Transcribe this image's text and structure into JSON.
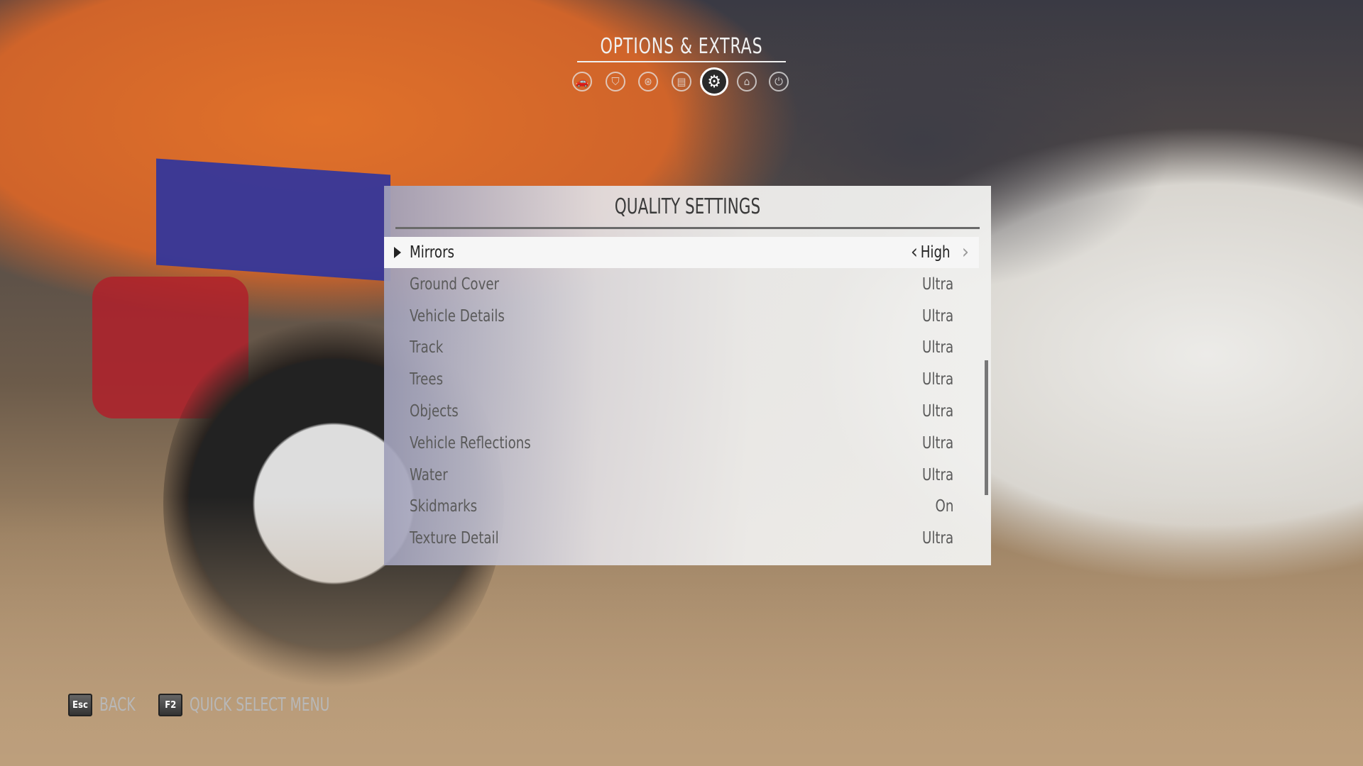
{
  "header": {
    "title": "OPTIONS & EXTRAS",
    "tabs": [
      {
        "icon": "car-icon",
        "glyph": "🚗"
      },
      {
        "icon": "badge-icon",
        "glyph": "⛉"
      },
      {
        "icon": "wheel-icon",
        "glyph": "⊛"
      },
      {
        "icon": "id-card-icon",
        "glyph": "▤"
      },
      {
        "icon": "gears-icon",
        "glyph": "⚙",
        "active": true
      },
      {
        "icon": "graduation-cap-icon",
        "glyph": "⌂"
      },
      {
        "icon": "power-icon",
        "glyph": "⏻"
      }
    ]
  },
  "panel": {
    "title": "QUALITY SETTINGS",
    "rows": [
      {
        "label": "Mirrors",
        "value": "High"
      },
      {
        "label": "Ground Cover",
        "value": "Ultra"
      },
      {
        "label": "Vehicle Details",
        "value": "Ultra"
      },
      {
        "label": "Track",
        "value": "Ultra"
      },
      {
        "label": "Trees",
        "value": "Ultra"
      },
      {
        "label": "Objects",
        "value": "Ultra"
      },
      {
        "label": "Vehicle Reflections",
        "value": "Ultra"
      },
      {
        "label": "Water",
        "value": "Ultra"
      },
      {
        "label": "Skidmarks",
        "value": "On"
      },
      {
        "label": "Texture Detail",
        "value": "Ultra"
      }
    ]
  },
  "footer": {
    "back_key": "Esc",
    "back_label": "BACK",
    "quick_key": "F2",
    "quick_label": "QUICK SELECT MENU"
  }
}
